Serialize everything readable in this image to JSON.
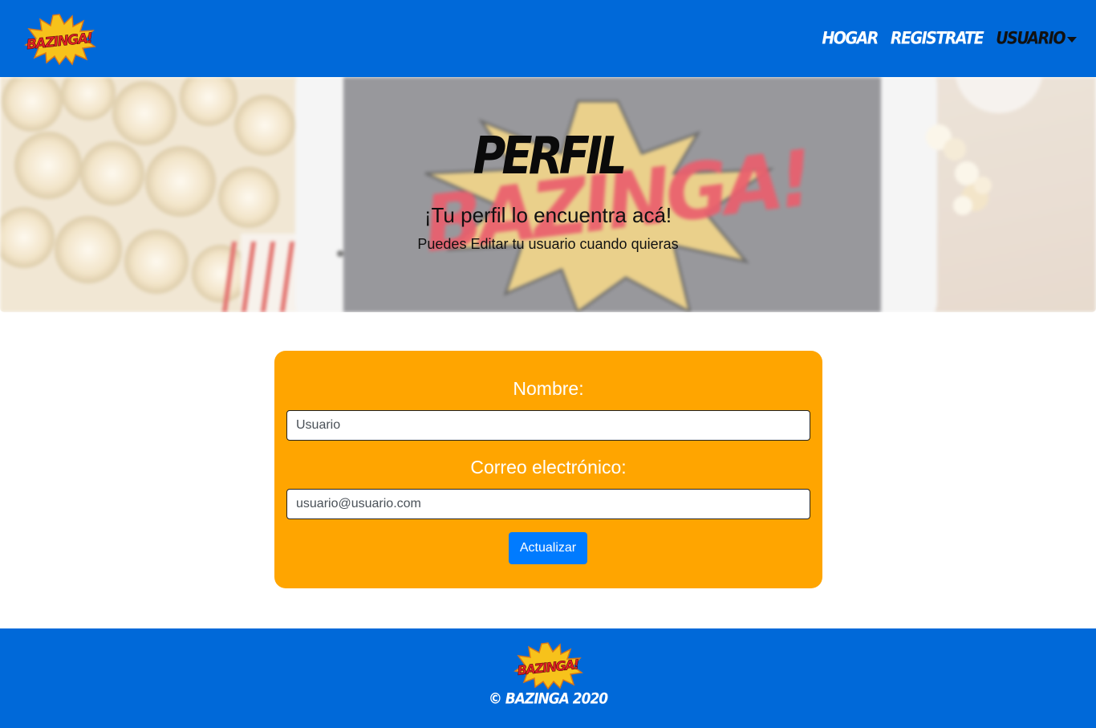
{
  "brand": {
    "logo_text": "BAZINGA!",
    "logo_icon": "bazinga-burst-logo"
  },
  "nav": {
    "items": [
      {
        "label": "Hogar"
      },
      {
        "label": "Registrate"
      },
      {
        "label": "Usuario"
      }
    ],
    "dropdown_icon": "caret-down-icon"
  },
  "hero": {
    "title": "Perfil",
    "subtitle": "¡Tu perfil lo encuentra acá!",
    "text": "Puedes Editar tu usuario cuando quieras",
    "background_art_text": "BAZINGA!"
  },
  "form": {
    "name_label": "Nombre:",
    "name_value": "Usuario",
    "email_label": "Correo electrónico:",
    "email_value": "usuario@usuario.com",
    "submit_label": "Actualizar"
  },
  "footer": {
    "copyright": "© Bazinga 2020"
  },
  "colors": {
    "primary": "#0069d9",
    "card": "#ffa500",
    "button": "#007bff"
  }
}
